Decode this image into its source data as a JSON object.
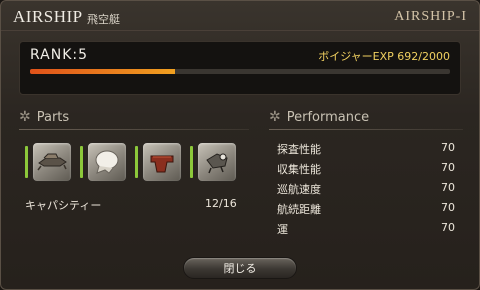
{
  "window": {
    "title": "AIRSHIP",
    "subtitle": "飛空艇",
    "airship_id": "AIRSHIP-I"
  },
  "rank": {
    "label": "RANK:5",
    "exp_text": "ボイジャーEXP 692/2000",
    "exp_current": 692,
    "exp_max": 2000
  },
  "parts": {
    "heading": "Parts",
    "items": [
      {
        "icon": "hull-part-icon",
        "status_color": "#8cc83a"
      },
      {
        "icon": "rigging-part-icon",
        "status_color": "#8cc83a"
      },
      {
        "icon": "forecastle-part-icon",
        "status_color": "#8cc83a"
      },
      {
        "icon": "aftcastle-part-icon",
        "status_color": "#8cc83a"
      }
    ],
    "capacity_label": "キャパシティー",
    "capacity_value": "12/16"
  },
  "performance": {
    "heading": "Performance",
    "stats": [
      {
        "label": "探査性能",
        "value": "70"
      },
      {
        "label": "収集性能",
        "value": "70"
      },
      {
        "label": "巡航速度",
        "value": "70"
      },
      {
        "label": "航続距離",
        "value": "70"
      },
      {
        "label": "運",
        "value": "70"
      }
    ]
  },
  "footer": {
    "close_label": "閉じる"
  },
  "colors": {
    "exp_fill_start": "#e0521a",
    "exp_fill_end": "#f0a020",
    "exp_text": "#f0d060",
    "part_ok": "#8cc83a"
  }
}
